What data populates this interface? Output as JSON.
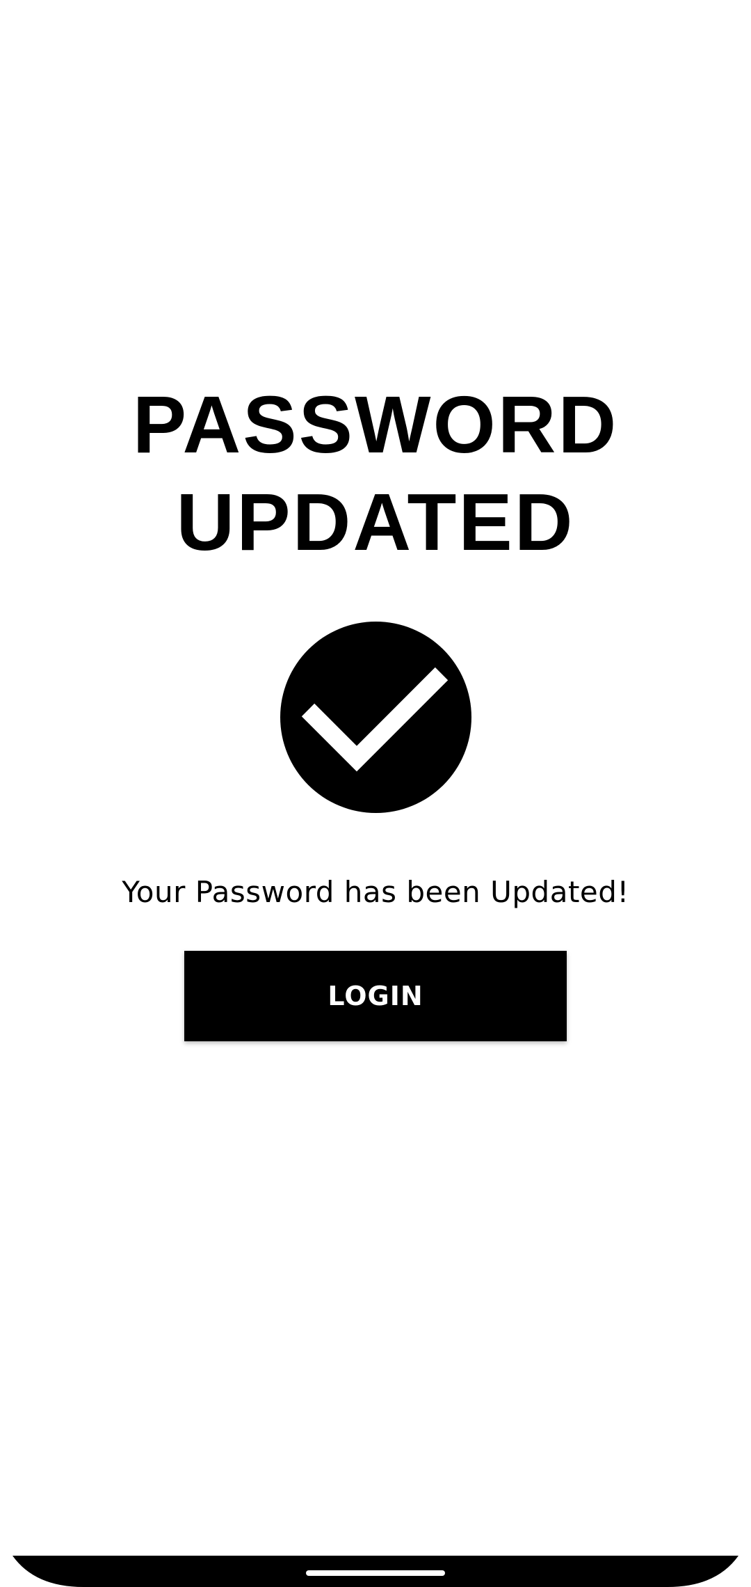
{
  "screen": {
    "title_line1": "PASSWORD",
    "title_line2": "UPDATED",
    "status_icon": "check-circle-icon",
    "message": "Your Password has been Updated!",
    "login_button_label": "LOGIN"
  },
  "system": {
    "nav_bar_color": "#000000",
    "home_indicator_color": "#ffffff"
  }
}
